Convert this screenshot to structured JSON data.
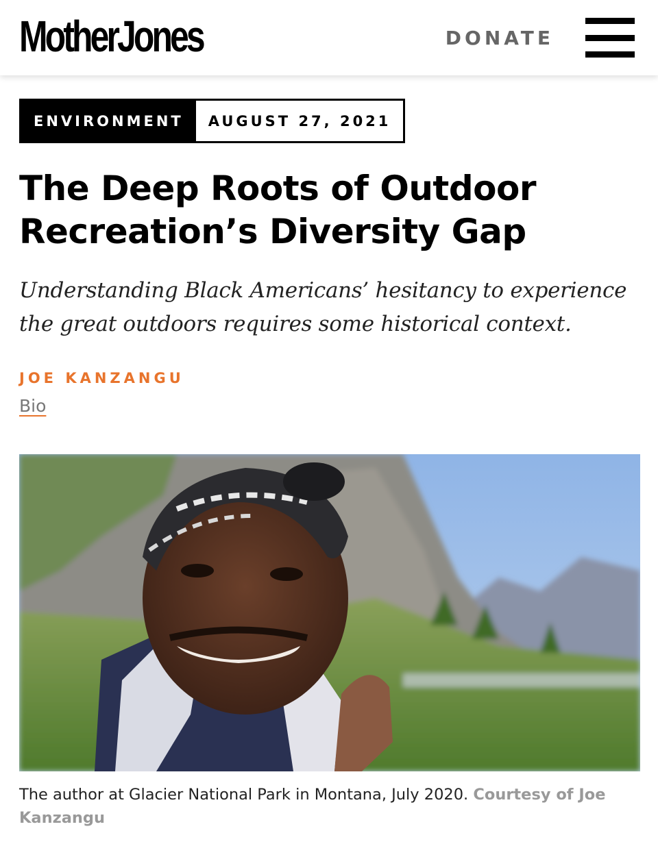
{
  "header": {
    "logo": "MotherJones",
    "donate_label": "DONATE"
  },
  "article": {
    "section": "ENVIRONMENT",
    "date": "AUGUST 27, 2021",
    "headline": "The Deep Roots of Outdoor Recreation’s Diversity Gap",
    "dek": "Understanding Black Americans’ hesitancy to experience the great outdoors requires some historical context.",
    "author": "JOE KANZANGU",
    "bio_label": "Bio",
    "caption": "The author at Glacier National Park in Montana, July 2020.",
    "credit": "Courtesy of Joe Kanzangu"
  },
  "colors": {
    "accent": "#e8742c",
    "donate": "#666666",
    "credit": "#999999"
  },
  "icons": {
    "menu": "hamburger-menu-icon"
  }
}
